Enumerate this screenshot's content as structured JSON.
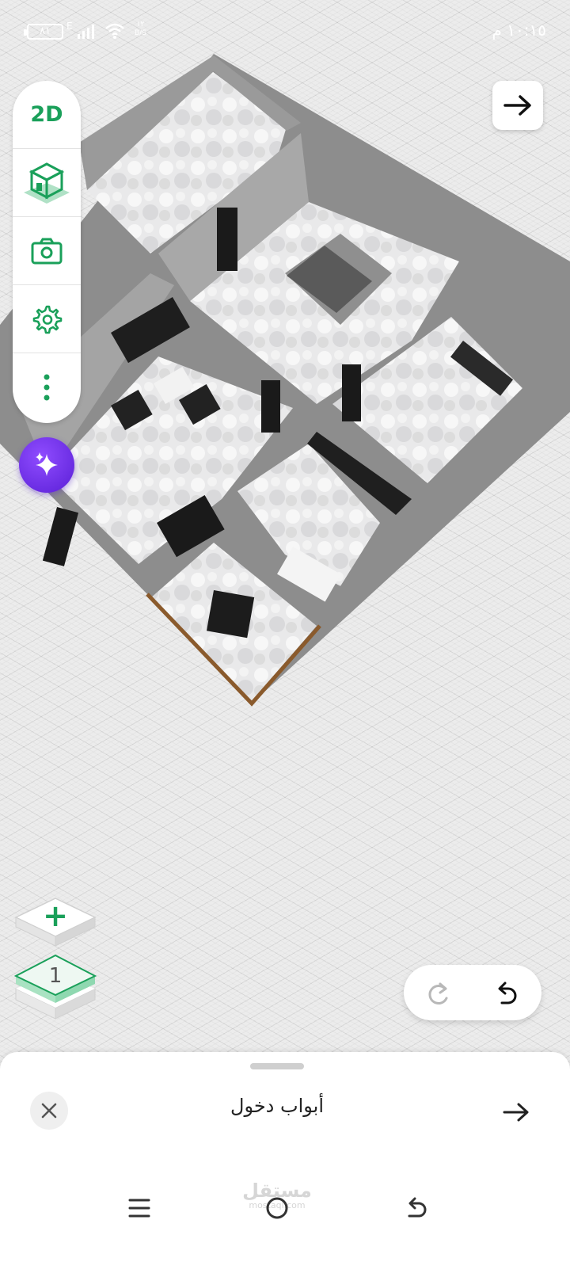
{
  "status_bar": {
    "time": "١٠:١٥ م",
    "battery": "٨١",
    "network_type": "E",
    "speed_value": "١٢",
    "speed_unit": "B/S"
  },
  "toolbar": {
    "view_2d_label": "2D",
    "items": [
      "view-2d",
      "view-3d-icon",
      "camera-icon",
      "gear-icon",
      "more-vertical-icon"
    ],
    "accent_color": "#1aa05a"
  },
  "floors": {
    "add_label": "+",
    "current_floor": "1"
  },
  "bottom_sheet": {
    "title": "أبواب دخول"
  },
  "nav_bar": {
    "watermark_text": "مستقل",
    "watermark_sub": "mostaql.com"
  },
  "colors": {
    "accent": "#1aa05a",
    "ai_button": "#6b2ee8"
  }
}
